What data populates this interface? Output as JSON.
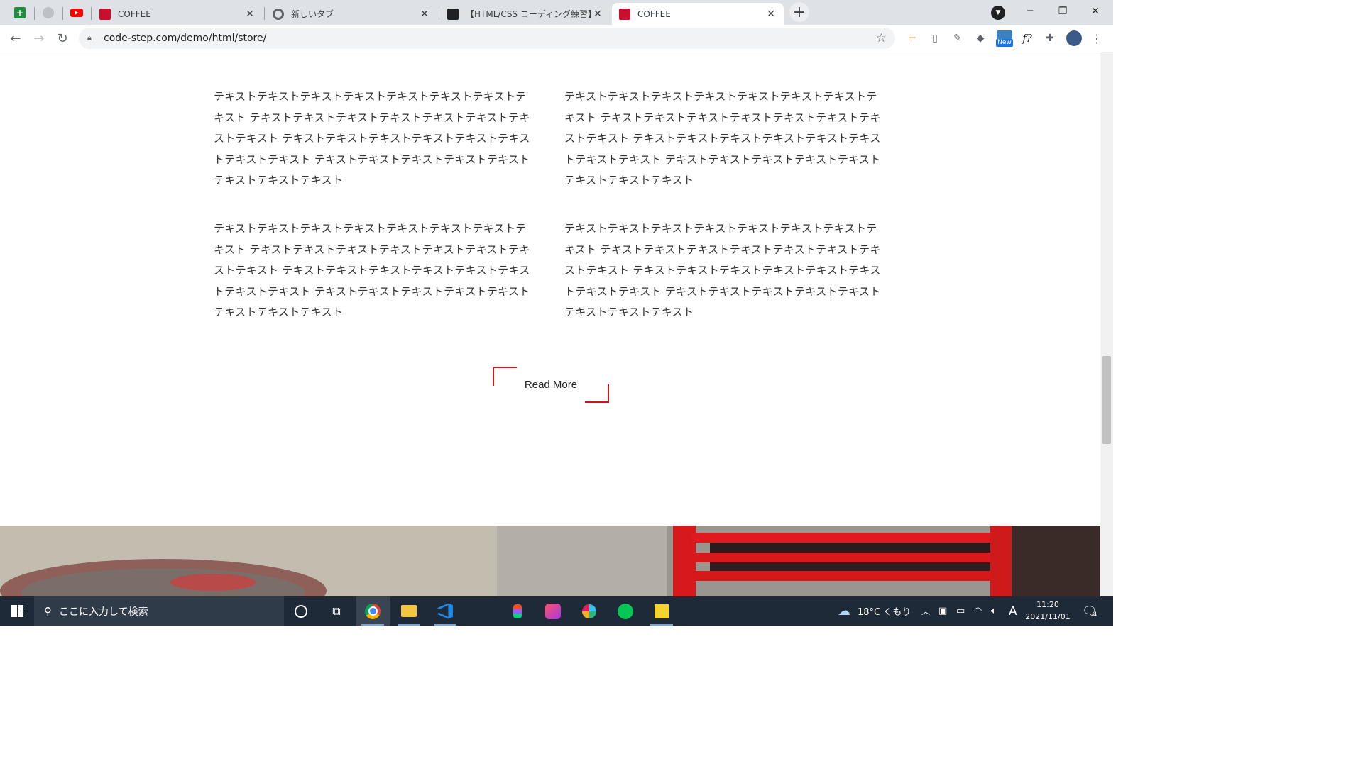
{
  "browser": {
    "tabs": [
      {
        "title": "COFFEE",
        "favicon": "coffee-favicon"
      },
      {
        "title": "新しいタブ",
        "favicon": "chrome-icon"
      },
      {
        "title": "【HTML/CSS コーディング練習】中級",
        "favicon": "codestep-favicon"
      },
      {
        "title": "COFFEE",
        "favicon": "coffee-favicon",
        "active": true
      }
    ],
    "pinned_tabs": [
      "google-sheets-icon",
      "generic-site-icon",
      "youtube-icon"
    ],
    "new_tab_label": "+",
    "url": "code-step.com/demo/html/store/",
    "new_badge": "New",
    "font_ext_label": "f?"
  },
  "content": {
    "paragraphs": [
      "テキストテキストテキストテキストテキストテキストテキストテキスト テキストテキストテキストテキストテキストテキストテキストテキスト テキストテキストテキストテキストテキストテキストテキストテキスト テキストテキストテキストテキストテキストテキストテキストテキスト",
      "テキストテキストテキストテキストテキストテキストテキストテキスト テキストテキストテキストテキストテキストテキストテキストテキスト テキストテキストテキストテキストテキストテキストテキストテキスト テキストテキストテキストテキストテキストテキストテキストテキスト",
      "テキストテキストテキストテキストテキストテキストテキストテキスト テキストテキストテキストテキストテキストテキストテキストテキスト テキストテキストテキストテキストテキストテキストテキストテキスト テキストテキストテキストテキストテキストテキストテキストテキスト",
      "テキストテキストテキストテキストテキストテキストテキストテキスト テキストテキストテキストテキストテキストテキストテキストテキスト テキストテキストテキストテキストテキストテキストテキストテキスト テキストテキストテキストテキストテキストテキストテキストテキスト"
    ],
    "read_more": "Read More",
    "accent_color": "#d1161b"
  },
  "taskbar": {
    "search_placeholder": "ここに入力して検索",
    "weather": "18°C くもり",
    "ime": "A",
    "time": "11:20",
    "date": "2021/11/01",
    "notifications": "4"
  }
}
